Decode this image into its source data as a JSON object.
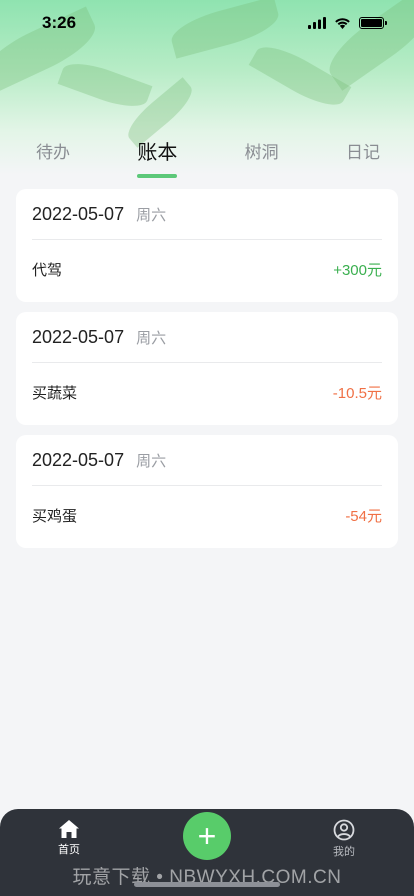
{
  "status_bar": {
    "time": "3:26"
  },
  "tabs": [
    {
      "label": "待办",
      "active": false
    },
    {
      "label": "账本",
      "active": true
    },
    {
      "label": "树洞",
      "active": false
    },
    {
      "label": "日记",
      "active": false
    }
  ],
  "entries": [
    {
      "date": "2022-05-07",
      "weekday": "周六",
      "item": "代驾",
      "amount": "+300元",
      "type": "income"
    },
    {
      "date": "2022-05-07",
      "weekday": "周六",
      "item": "买蔬菜",
      "amount": "-10.5元",
      "type": "expense"
    },
    {
      "date": "2022-05-07",
      "weekday": "周六",
      "item": "买鸡蛋",
      "amount": "-54元",
      "type": "expense"
    }
  ],
  "tabbar": {
    "home_label": "首页",
    "add_label": "+",
    "mine_label": "我的"
  },
  "watermark": "玩意下载 • NBWYXH.COM.CN",
  "colors": {
    "accent": "#58cc6a",
    "income": "#3aaf4f",
    "expense": "#f07045",
    "tabbar_bg": "#2f333a"
  }
}
